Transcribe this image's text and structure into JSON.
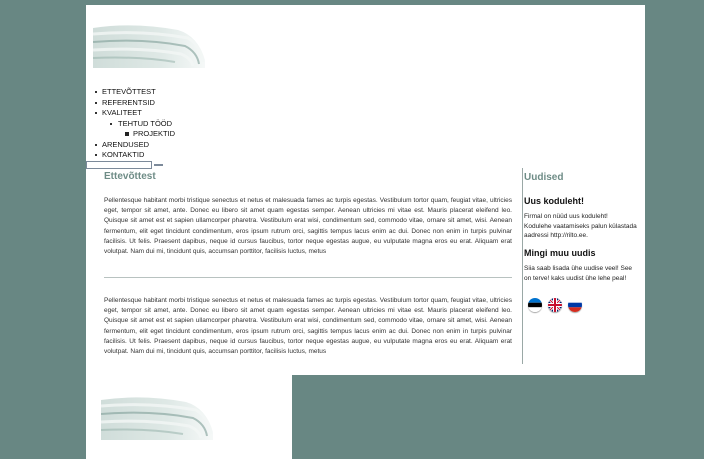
{
  "nav": {
    "items": [
      {
        "label": "ETTEVÕTTEST",
        "level": 1
      },
      {
        "label": "REFERENTSID",
        "level": 1
      },
      {
        "label": "KVALITEET",
        "level": 1
      },
      {
        "label": "TEHTUD TÖÖD",
        "level": 2
      },
      {
        "label": "PROJEKTID",
        "level": 3
      },
      {
        "label": "ARENDUSED",
        "level": 1
      },
      {
        "label": "KONTAKTID",
        "level": 1
      }
    ]
  },
  "search": {
    "value": "",
    "button_label": ""
  },
  "main": {
    "title": "Ettevõttest",
    "paragraphs": [
      "Pellentesque habitant morbi tristique senectus et netus et malesuada fames ac turpis egestas. Vestibulum tortor quam, feugiat vitae, ultricies eget, tempor sit amet, ante. Donec eu libero sit amet quam egestas semper. Aenean ultricies mi vitae est. Mauris placerat eleifend leo. Quisque sit amet est et sapien ullamcorper pharetra. Vestibulum erat wisi, condimentum sed, commodo vitae, ornare sit amet, wisi. Aenean fermentum, elit eget tincidunt condimentum, eros ipsum rutrum orci, sagittis tempus lacus enim ac dui. Donec non enim in turpis pulvinar facilisis. Ut felis. Praesent dapibus, neque id cursus faucibus, tortor neque egestas augue, eu vulputate magna eros eu erat. Aliquam erat volutpat. Nam dui mi, tincidunt quis, accumsan porttitor, facilisis luctus, metus",
      "Pellentesque habitant morbi tristique senectus et netus et malesuada fames ac turpis egestas. Vestibulum tortor quam, feugiat vitae, ultricies eget, tempor sit amet, ante. Donec eu libero sit amet quam egestas semper. Aenean ultricies mi vitae est. Mauris placerat eleifend leo. Quisque sit amet est et sapien ullamcorper pharetra. Vestibulum erat wisi, condimentum sed, commodo vitae, ornare sit amet, wisi. Aenean fermentum, elit eget tincidunt condimentum, eros ipsum rutrum orci, sagittis tempus lacus enim ac dui. Donec non enim in turpis pulvinar facilisis. Ut felis. Praesent dapibus, neque id cursus faucibus, tortor neque egestas augue, eu vulputate magna eros eu erat. Aliquam erat volutpat. Nam dui mi, tincidunt quis, accumsan porttitor, facilisis luctus, metus"
    ]
  },
  "sidebar": {
    "heading": "Uudised",
    "news": [
      {
        "title": "Uus koduleht!",
        "text": "Firmal on nüüd uus koduleht! Kodulehe vaatamiseks palun külastada aadressi http://rilto.ee."
      },
      {
        "title": "Mingi muu uudis",
        "text": "Siia saab lisada ühe uudise veel! See on terve! kaks uudist ühe lehe peal!"
      }
    ],
    "flags": [
      "estonian-flag-icon",
      "british-flag-icon",
      "russian-flag-icon"
    ]
  },
  "colors": {
    "background": "#688783",
    "heading": "#6e8c86",
    "page": "#ffffff"
  }
}
